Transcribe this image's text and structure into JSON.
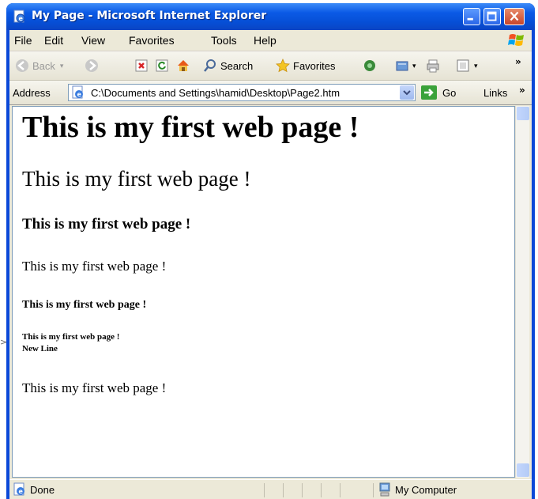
{
  "window": {
    "title": "My Page - Microsoft Internet Explorer"
  },
  "menu": {
    "items": [
      "File",
      "Edit",
      "View",
      "Favorites",
      "Tools",
      "Help"
    ]
  },
  "toolbar": {
    "back_label": "Back",
    "search_label": "Search",
    "favorites_label": "Favorites"
  },
  "address": {
    "label": "Address",
    "value": "C:\\Documents and Settings\\hamid\\Desktop\\Page2.htm",
    "go_label": "Go",
    "links_label": "Links"
  },
  "content": {
    "h1": "This is my first web page !",
    "h2": "This is my first web page !",
    "h3": "This is my first web page !",
    "h4": "This is my first web page !",
    "h5": "This is my first web page !",
    "h6_line1": "This is my first web page !",
    "h6_line2": "New Line",
    "paragraph": "This is my first web page !"
  },
  "status": {
    "text": "Done",
    "zone": "My Computer"
  },
  "colors": {
    "title_bar": "#0b5ae6",
    "chrome": "#ece9d8",
    "close_button": "#c8452a"
  }
}
